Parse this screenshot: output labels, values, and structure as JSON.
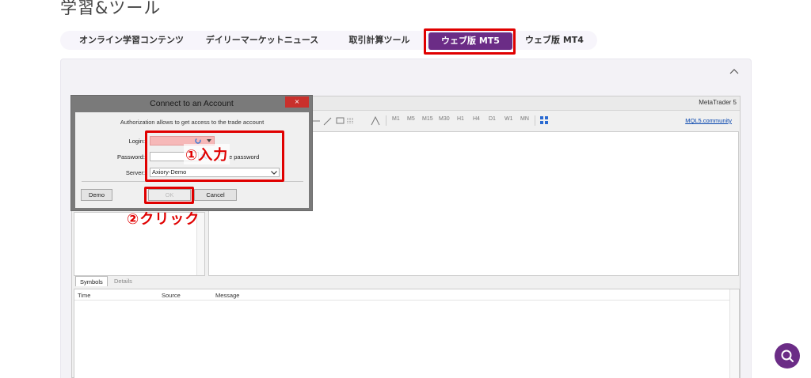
{
  "page": {
    "title": "学習&ツール"
  },
  "tabs": [
    {
      "label": "オンライン学習コンテンツ"
    },
    {
      "label": "デイリーマーケットニュース"
    },
    {
      "label": "取引計算ツール"
    },
    {
      "label": "ウェブ版 MT5",
      "active": true
    },
    {
      "label": "ウェブ版 MT4"
    }
  ],
  "platform": {
    "brand": "MetaTrader 5",
    "timeframes": [
      "M1",
      "M5",
      "M15",
      "M30",
      "H1",
      "H4",
      "D1",
      "W1",
      "MN"
    ],
    "community_link": "MQL5.community",
    "subtabs": [
      "Symbols",
      "Details"
    ],
    "log_columns": [
      "Time",
      "Source",
      "Message"
    ]
  },
  "dialog": {
    "title": "Connect to an Account",
    "close_label": "×",
    "description": "Authorization allows to get access to the trade account",
    "login_label": "Login:",
    "login_value": "",
    "password_label": "Password:",
    "password_value": "",
    "save_password_label": "e password",
    "server_label": "Server:",
    "server_value": "Axiory-Demo",
    "demo_button": "Demo",
    "ok_button": "OK",
    "cancel_button": "Cancel"
  },
  "annotations": {
    "step1": "①入力",
    "step2": "②クリック"
  },
  "colors": {
    "accent": "#6b2c86",
    "highlight": "#e00000",
    "login_field": "#f6b8b8"
  }
}
